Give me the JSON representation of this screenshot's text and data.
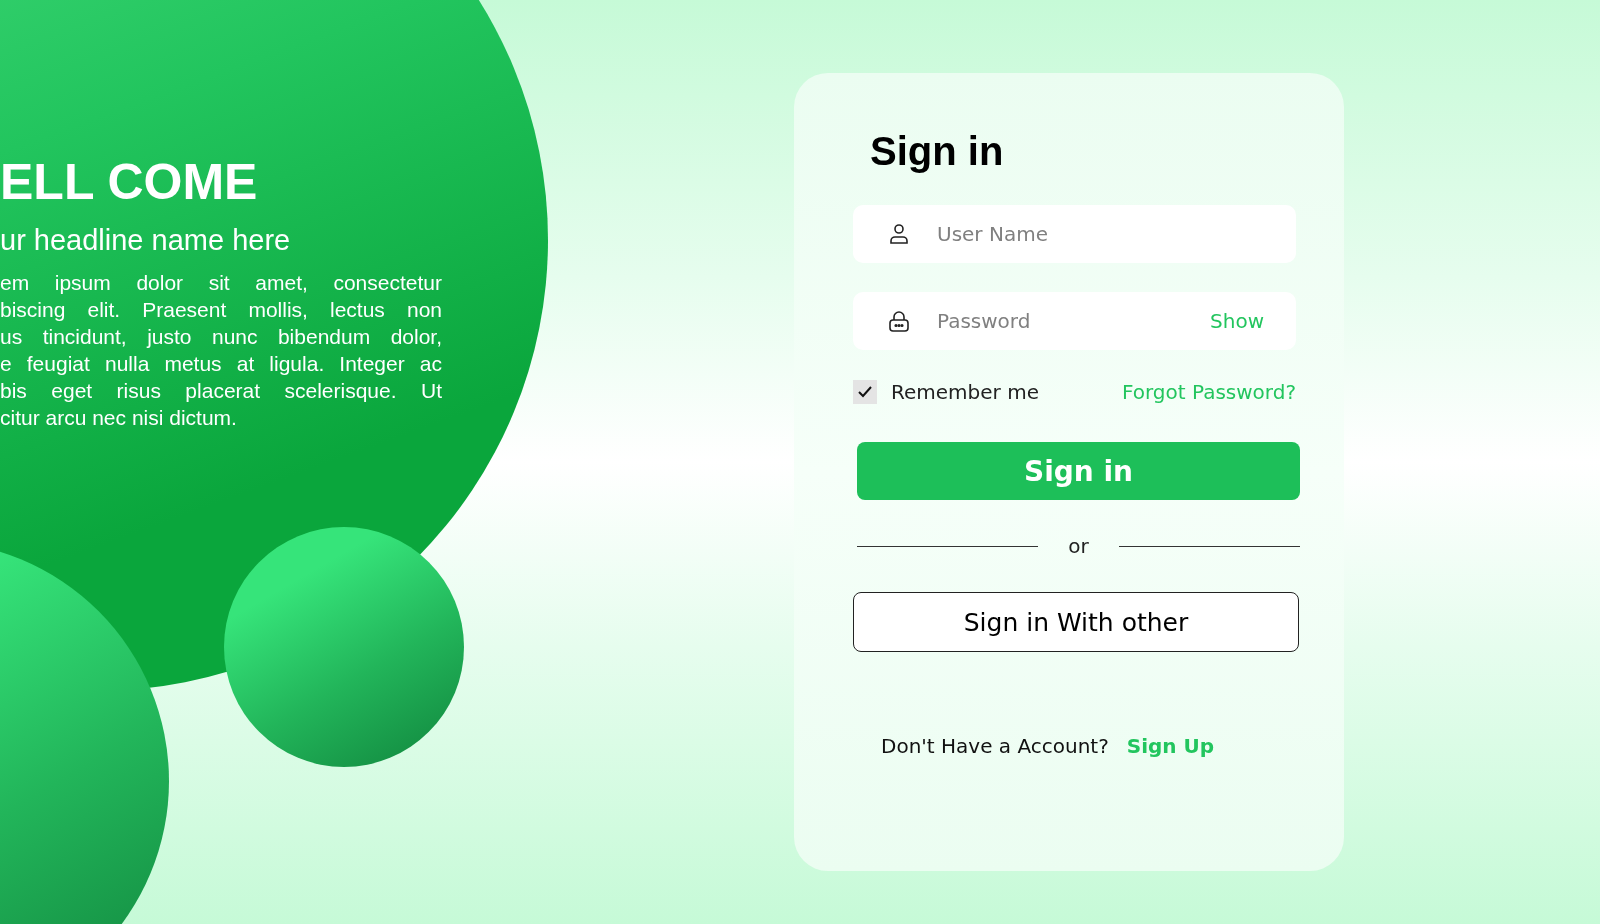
{
  "hero": {
    "title": "ELL COME",
    "headline": "ur headline name here",
    "paragraph_lines": [
      "em ipsum dolor sit amet, consectetur",
      "biscing elit. Praesent mollis, lectus non",
      "us tincidunt, justo nunc bibendum dolor,",
      "e feugiat nulla metus at ligula. Integer ac",
      "bis eget risus placerat scelerisque. Ut",
      "citur arcu nec nisi dictum."
    ]
  },
  "form": {
    "title": "Sign in",
    "username": {
      "placeholder": "User Name"
    },
    "password": {
      "placeholder": "Password",
      "toggle": "Show"
    },
    "remember": {
      "label": "Remember me",
      "checked": true
    },
    "forgot": "Forgot Password?",
    "submit": "Sign in",
    "divider": "or",
    "alternate": "Sign in With other",
    "signup": {
      "prompt": "Don't Have a Account?",
      "link": "Sign Up"
    }
  }
}
